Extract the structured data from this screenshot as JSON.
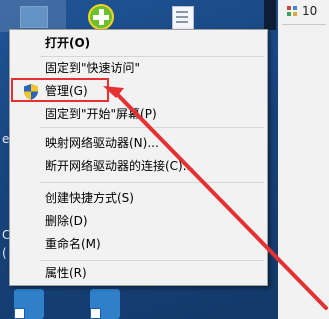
{
  "menu": {
    "items": [
      {
        "label": "打开(O)"
      },
      {
        "label": "固定到\"快速访问\""
      },
      {
        "label": "管理(G)"
      },
      {
        "label": "固定到\"开始\"屏幕(P)"
      },
      {
        "label": "映射网络驱动器(N)..."
      },
      {
        "label": "断开网络驱动器的连接(C)..."
      },
      {
        "label": "创建快捷方式(S)"
      },
      {
        "label": "删除(D)"
      },
      {
        "label": "重命名(M)"
      },
      {
        "label": "属性(R)"
      }
    ]
  },
  "right_panel": {
    "text": "10"
  },
  "edge_chars": [
    "e",
    "C",
    "("
  ],
  "colors": {
    "highlight_box": "#e53131",
    "arrow": "#e53131",
    "desktop": "#1d4a84"
  },
  "icons": [
    "computer-icon",
    "green-plus-icon",
    "document-icon",
    "shield-icon",
    "shortcut-icon"
  ]
}
